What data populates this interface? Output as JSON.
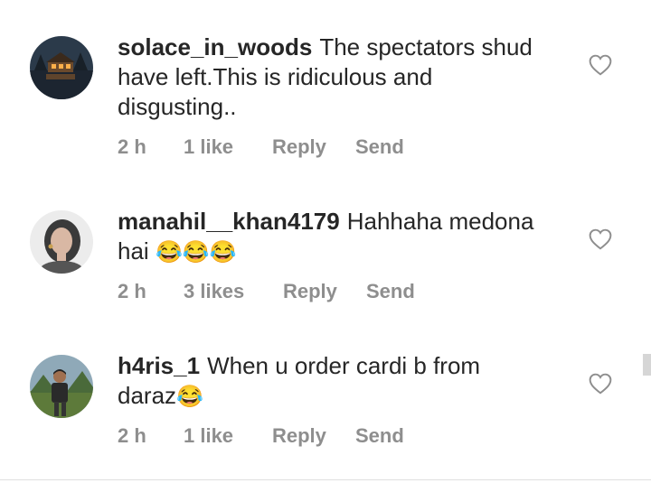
{
  "comments": [
    {
      "username": "solace_in_woods",
      "text": "The spectators shud have left.This is ridiculous and disgusting..",
      "emoji": "",
      "time": "2 h",
      "likes": "1 like",
      "reply_label": "Reply",
      "send_label": "Send"
    },
    {
      "username": "manahil__khan4179",
      "text": "Hahhaha medona hai",
      "emoji": "😂😂😂",
      "time": "2 h",
      "likes": "3 likes",
      "reply_label": "Reply",
      "send_label": "Send"
    },
    {
      "username": "h4ris_1",
      "text": "When u order cardi b from daraz",
      "emoji": "😂",
      "time": "2 h",
      "likes": "1 like",
      "reply_label": "Reply",
      "send_label": "Send"
    }
  ],
  "icons": {
    "like": "heart-outline-icon"
  },
  "colors": {
    "text": "#262626",
    "meta": "#8e8e8e"
  }
}
